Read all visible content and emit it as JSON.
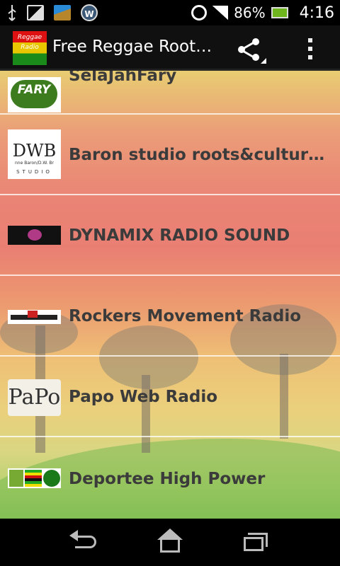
{
  "status_bar": {
    "battery_percent": "86%",
    "time": "4:16",
    "icons": [
      "usb-icon",
      "image-icon",
      "broom-icon",
      "w-app-icon",
      "alarm-icon",
      "signal-icon",
      "battery-charging-icon"
    ]
  },
  "action_bar": {
    "app_icon_text": "Reggae Radio",
    "title": "Free Reggae Root…",
    "share_icon": "share-icon",
    "overflow_icon": "overflow-menu-icon"
  },
  "stations": [
    {
      "label": "SelaJahFary",
      "thumb_text": "FARY"
    },
    {
      "label": "Baron studio roots&culture vi…",
      "thumb_text": "DWB",
      "thumb_subtext": "nne Baron/D.W. Br",
      "thumb_studio": "STUDIO"
    },
    {
      "label": "DYNAMIX RADIO SOUND"
    },
    {
      "label": "Rockers Movement Radio"
    },
    {
      "label": "Papo Web Radio",
      "thumb_text": "PaPo"
    },
    {
      "label": "Deportee High Power"
    }
  ],
  "nav_bar": {
    "back": "back-icon",
    "home": "home-icon",
    "recents": "recent-apps-icon"
  },
  "colors": {
    "list_text": "#3b3b3b",
    "divider": "#ffffff",
    "bar_background": "#000000"
  }
}
